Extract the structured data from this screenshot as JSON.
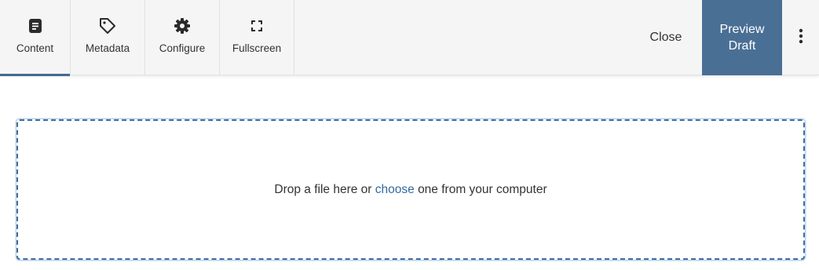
{
  "toolbar": {
    "tabs": [
      {
        "label": "Content",
        "icon": "document-icon",
        "active": true
      },
      {
        "label": "Metadata",
        "icon": "tag-icon",
        "active": false
      },
      {
        "label": "Configure",
        "icon": "gear-icon",
        "active": false
      },
      {
        "label": "Fullscreen",
        "icon": "fullscreen-icon",
        "active": false
      }
    ],
    "close_label": "Close",
    "preview_label_line1": "Preview",
    "preview_label_line2": "Draft",
    "more_icon": "more-vertical-icon"
  },
  "dropzone": {
    "text_before": "Drop a file here or",
    "link_text": "choose",
    "text_after": "one from your computer"
  },
  "colors": {
    "accent": "#4a6f95",
    "link": "#2f6aa0",
    "toolbar_bg": "#f5f5f5",
    "dropzone_border": "#3f6c9c"
  }
}
